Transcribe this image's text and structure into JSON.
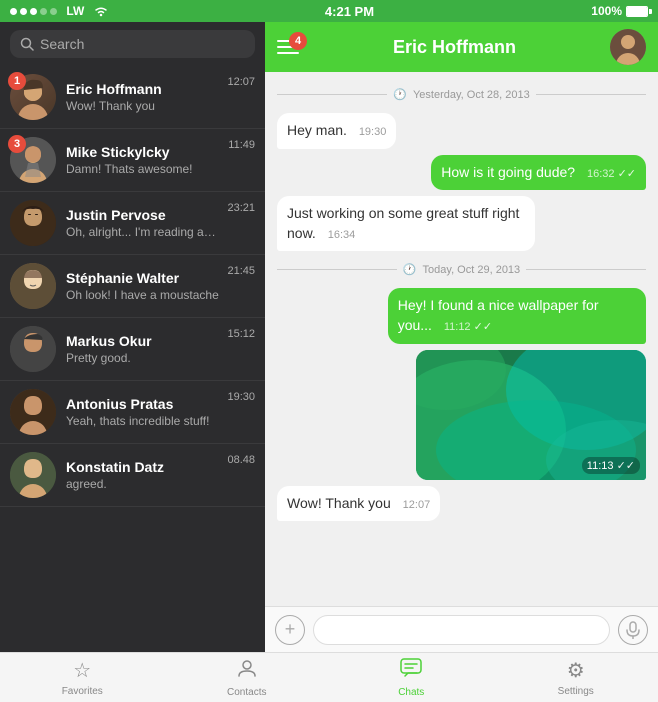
{
  "statusBar": {
    "dots": [
      "on",
      "on",
      "on",
      "off",
      "off"
    ],
    "carrier": "LW",
    "wifi": true,
    "time": "4:21 PM",
    "battery": "100%"
  },
  "search": {
    "placeholder": "Search"
  },
  "chats": [
    {
      "id": 1,
      "name": "Eric Hoffmann",
      "preview": "Wow! Thank you",
      "time": "12:07",
      "badge": 1
    },
    {
      "id": 2,
      "name": "Mike Stickylcky",
      "preview": "Damn! Thats awesome!",
      "time": "11:49",
      "badge": 3
    },
    {
      "id": 3,
      "name": "Justin Pervose",
      "preview": "Oh, alright... I'm reading an amazing article at...",
      "time": "23:21",
      "badge": 0
    },
    {
      "id": 4,
      "name": "Stéphanie Walter",
      "preview": "Oh look! I have a moustache",
      "time": "21:45",
      "badge": 0
    },
    {
      "id": 5,
      "name": "Markus Okur",
      "preview": "Pretty good.",
      "time": "15:12",
      "badge": 0
    },
    {
      "id": 6,
      "name": "Antonius Pratas",
      "preview": "Yeah, thats incredible stuff!",
      "time": "19:30",
      "badge": 0
    },
    {
      "id": 7,
      "name": "Konstatin Datz",
      "preview": "agreed.",
      "time": "08.48",
      "badge": 0
    }
  ],
  "activeChat": {
    "name": "Eric Hoffmann",
    "badgeCount": "4",
    "dateDivider1": "Yesterday, Oct 28, 2013",
    "dateDivider2": "Today, Oct 29, 2013",
    "messages": [
      {
        "id": 1,
        "text": "Hey man.",
        "time": "19:30",
        "type": "received"
      },
      {
        "id": 2,
        "text": "How is it going dude?",
        "time": "16:32",
        "type": "sent",
        "checks": "✓✓"
      },
      {
        "id": 3,
        "text": "Just working on some great stuff right now.",
        "time": "16:34",
        "type": "received"
      },
      {
        "id": 4,
        "text": "Hey! I found a nice wallpaper for you...",
        "time": "11:12",
        "type": "sent",
        "checks": "✓✓"
      },
      {
        "id": 5,
        "text": "",
        "time": "11:13",
        "type": "sent-image",
        "checks": "✓✓"
      },
      {
        "id": 6,
        "text": "Wow! Thank you",
        "time": "12:07",
        "type": "received"
      }
    ]
  },
  "bottomNav": {
    "items": [
      {
        "id": "favorites",
        "label": "Favorites",
        "icon": "☆"
      },
      {
        "id": "contacts",
        "label": "Contacts",
        "icon": "👤"
      },
      {
        "id": "chats",
        "label": "Chats",
        "icon": "💬",
        "active": true
      },
      {
        "id": "settings",
        "label": "Settings",
        "icon": "⚙"
      }
    ]
  },
  "inputBar": {
    "placeholder": ""
  }
}
